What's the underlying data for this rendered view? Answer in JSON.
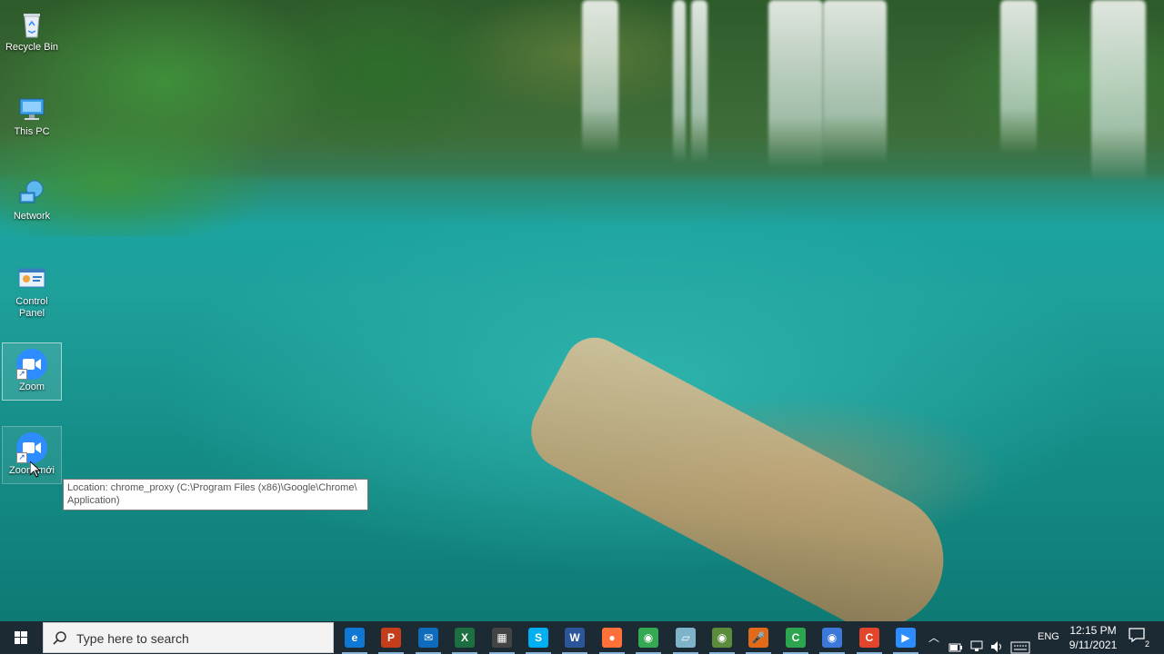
{
  "desktop_icons": [
    {
      "name": "recycle-bin",
      "label": "Recycle Bin"
    },
    {
      "name": "this-pc",
      "label": "This PC"
    },
    {
      "name": "network",
      "label": "Network"
    },
    {
      "name": "control-panel",
      "label": "Control Panel"
    },
    {
      "name": "zoom",
      "label": "Zoom"
    },
    {
      "name": "zoom-moi",
      "label": "Zoom mới"
    }
  ],
  "tooltip": {
    "text": "Location: chrome_proxy (C:\\Program Files (x86)\\Google\\Chrome\\ Application)"
  },
  "taskbar": {
    "search_placeholder": "Type here to search",
    "apps": [
      {
        "name": "edge",
        "glyph": "e",
        "color": "#0f78d4"
      },
      {
        "name": "powerpoint",
        "glyph": "P",
        "color": "#c43e1c"
      },
      {
        "name": "mail",
        "glyph": "✉",
        "color": "#0f6cbd"
      },
      {
        "name": "excel",
        "glyph": "X",
        "color": "#1d6f42"
      },
      {
        "name": "store",
        "glyph": "▦",
        "color": "#444"
      },
      {
        "name": "skype",
        "glyph": "S",
        "color": "#00aff0"
      },
      {
        "name": "word",
        "glyph": "W",
        "color": "#2b579a"
      },
      {
        "name": "firefox",
        "glyph": "●",
        "color": "#ff7139"
      },
      {
        "name": "chrome",
        "glyph": "◉",
        "color": "#34a853"
      },
      {
        "name": "notes",
        "glyph": "▱",
        "color": "#7fb3c9"
      },
      {
        "name": "chrome-alt",
        "glyph": "◉",
        "color": "#5b8c3c"
      },
      {
        "name": "microphone",
        "glyph": "🎤",
        "color": "#e06a1a"
      },
      {
        "name": "camtasia",
        "glyph": "C",
        "color": "#2da44e"
      },
      {
        "name": "chrome-profile",
        "glyph": "◉",
        "color": "#3c78d8"
      },
      {
        "name": "recorder",
        "glyph": "C",
        "color": "#e2452b"
      },
      {
        "name": "zoom-taskbar",
        "glyph": "▶",
        "color": "#2d8cff"
      }
    ],
    "tray": {
      "language": "ENG",
      "time": "12:15 PM",
      "date": "9/11/2021",
      "notification_count": "2"
    }
  }
}
